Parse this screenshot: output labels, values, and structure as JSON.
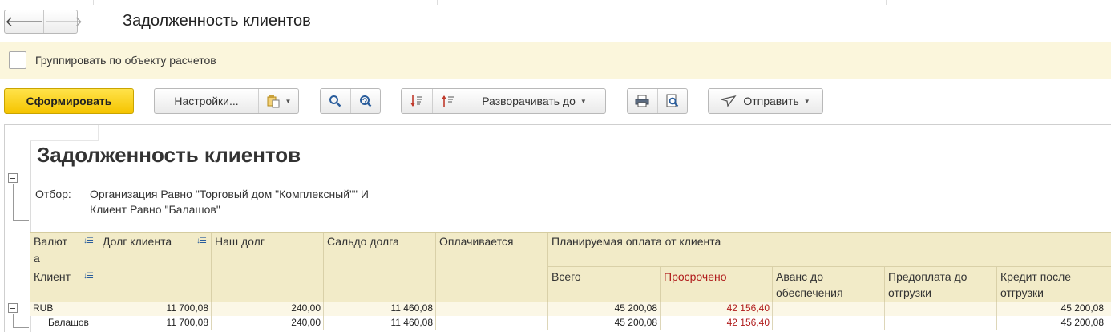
{
  "window": {
    "title": "Задолженность клиентов",
    "back_glyph": "🡐",
    "forward_glyph": "🡒"
  },
  "group_option": {
    "label": "Группировать по объекту расчетов",
    "checked": false
  },
  "toolbar": {
    "generate_label": "Сформировать",
    "settings_label": "Настройки...",
    "expand_label": "Разворачивать до",
    "send_label": "Отправить",
    "icons": [
      "variants-icon",
      "search-icon",
      "search-refresh-icon",
      "sort-desc-icon",
      "sort-asc-icon",
      "print-icon",
      "print-preview-icon",
      "send-icon"
    ]
  },
  "report": {
    "title": "Задолженность клиентов",
    "filter_label": "Отбор:",
    "filter_lines": [
      "Организация Равно \"Торговый дом \"Комплексный\"\" И",
      "Клиент Равно \"Балашов\""
    ],
    "columns": {
      "currency_part1": "Валют",
      "currency_part2": "а",
      "client": "Клиент",
      "client_debt": "Долг клиента",
      "our_debt": "Наш долг",
      "balance": "Сальдо долга",
      "being_paid": "Оплачивается",
      "planned": "Планируемая оплата от клиента",
      "total": "Всего",
      "overdue": "Просрочено",
      "advance_l1": "Аванс до",
      "advance_l2": "обеспечения",
      "prepay_l1": "Предоплата до",
      "prepay_l2": "отгрузки",
      "credit_l1": "Кредит после",
      "credit_l2": "отгрузки"
    },
    "rows": [
      {
        "label": "RUB",
        "client_debt": "11 700,08",
        "our_debt": "240,00",
        "balance": "11 460,08",
        "being_paid": "",
        "total": "45 200,08",
        "overdue": "42 156,40",
        "advance": "",
        "prepay": "",
        "credit": "45 200,08"
      },
      {
        "label": "Балашов",
        "client_debt": "11 700,08",
        "our_debt": "240,00",
        "balance": "11 460,08",
        "being_paid": "",
        "total": "45 200,08",
        "overdue": "42 156,40",
        "advance": "",
        "prepay": "",
        "credit": "45 200,08"
      }
    ]
  },
  "colors": {
    "primary_button": "#f5c400",
    "header_bg": "#f2ebc8",
    "group_panel_bg": "#fbf6dc",
    "overdue_text": "#b01c1c"
  }
}
